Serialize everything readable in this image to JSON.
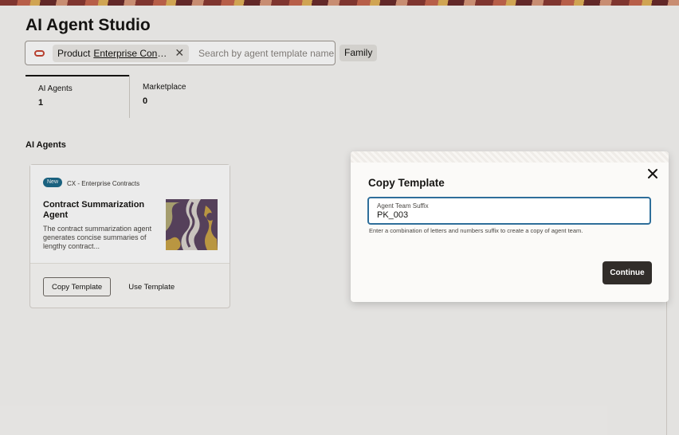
{
  "page": {
    "title": "AI Agent Studio"
  },
  "search": {
    "chip_key": "Product",
    "chip_value": "Enterprise Contr...",
    "placeholder": "Search by agent template name ...",
    "family_label": "Family"
  },
  "tabs": [
    {
      "label": "AI Agents",
      "count": "1"
    },
    {
      "label": "Marketplace",
      "count": "0"
    }
  ],
  "section": {
    "title": "AI Agents"
  },
  "card": {
    "badge": "New",
    "category": "CX - Enterprise Contracts",
    "title": "Contract Summarization Agent",
    "description": "The contract summarization agent generates concise summaries of lengthy contract...",
    "copy_button": "Copy Template",
    "use_button": "Use Template"
  },
  "dialog": {
    "title": "Copy Template",
    "field_label": "Agent Team Suffix",
    "field_value": "PK_003",
    "help_text": "Enter a combination of letters and numbers suffix to create a copy of agent team.",
    "continue_button": "Continue"
  },
  "colors": {
    "accent_blue": "#2e6e9a",
    "badge_blue": "#1d6a8a",
    "primary_button": "#312d2a",
    "oracle_red": "#c74634"
  }
}
